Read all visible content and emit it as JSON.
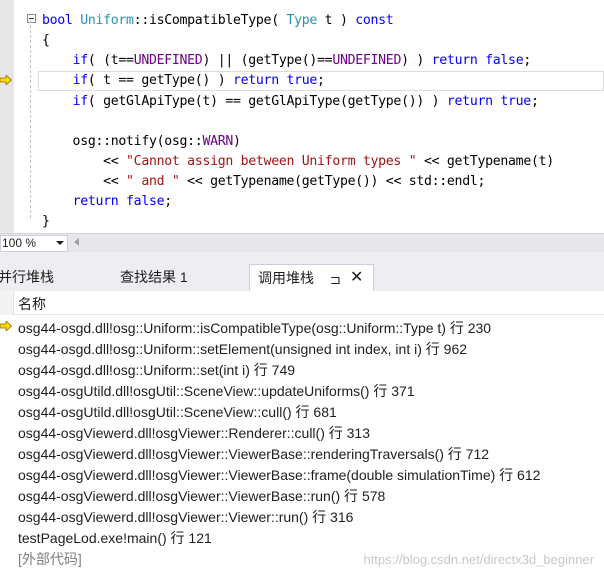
{
  "editor": {
    "lines": [
      [
        {
          "t": "bool",
          "c": "kw"
        },
        {
          "t": " "
        },
        {
          "t": "Uniform",
          "c": "ty"
        },
        {
          "t": "::isCompatibleType( "
        },
        {
          "t": "Type",
          "c": "ty"
        },
        {
          "t": " t ) "
        },
        {
          "t": "const",
          "c": "kw"
        }
      ],
      [
        {
          "t": "{"
        }
      ],
      [
        {
          "t": "    "
        },
        {
          "t": "if",
          "c": "kw"
        },
        {
          "t": "( (t=="
        },
        {
          "t": "UNDEFINED",
          "c": "mac"
        },
        {
          "t": ") || (getType()=="
        },
        {
          "t": "UNDEFINED",
          "c": "mac"
        },
        {
          "t": ") ) "
        },
        {
          "t": "return",
          "c": "kw"
        },
        {
          "t": " "
        },
        {
          "t": "false",
          "c": "kw"
        },
        {
          "t": ";"
        }
      ],
      [
        {
          "t": "    "
        },
        {
          "t": "if",
          "c": "kw"
        },
        {
          "t": "( t == getType() ) "
        },
        {
          "t": "return",
          "c": "kw"
        },
        {
          "t": " "
        },
        {
          "t": "true",
          "c": "kw"
        },
        {
          "t": ";"
        }
      ],
      [
        {
          "t": "    "
        },
        {
          "t": "if",
          "c": "kw"
        },
        {
          "t": "( getGlApiType(t) == getGlApiType(getType()) ) "
        },
        {
          "t": "return",
          "c": "kw"
        },
        {
          "t": " "
        },
        {
          "t": "true",
          "c": "kw"
        },
        {
          "t": ";"
        }
      ],
      [
        {
          "t": ""
        }
      ],
      [
        {
          "t": "    osg::notify(osg::"
        },
        {
          "t": "WARN",
          "c": "mac"
        },
        {
          "t": ")"
        }
      ],
      [
        {
          "t": "        << "
        },
        {
          "t": "\"Cannot assign between Uniform types \"",
          "c": "str"
        },
        {
          "t": " << getTypename(t)"
        }
      ],
      [
        {
          "t": "        << "
        },
        {
          "t": "\" and \"",
          "c": "str"
        },
        {
          "t": " << getTypename(getType()) << std::endl;"
        }
      ],
      [
        {
          "t": "    "
        },
        {
          "t": "return",
          "c": "kw"
        },
        {
          "t": " "
        },
        {
          "t": "false",
          "c": "kw"
        },
        {
          "t": ";"
        }
      ],
      [
        {
          "t": "}"
        }
      ]
    ]
  },
  "zoom": {
    "value": "100 %"
  },
  "tabs": {
    "parallel_stacks": "并行堆栈",
    "find_results": "查找结果 1",
    "call_stack": "调用堆栈",
    "pin_glyph": "⊐",
    "close_glyph": "✕"
  },
  "callstack": {
    "column_name": "名称",
    "frames": [
      "osg44-osgd.dll!osg::Uniform::isCompatibleType(osg::Uniform::Type t) 行 230",
      "osg44-osgd.dll!osg::Uniform::setElement(unsigned int index, int i) 行 962",
      "osg44-osgd.dll!osg::Uniform::set(int i) 行 749",
      "osg44-osgUtild.dll!osgUtil::SceneView::updateUniforms() 行 371",
      "osg44-osgUtild.dll!osgUtil::SceneView::cull() 行 681",
      "osg44-osgViewerd.dll!osgViewer::Renderer::cull() 行 313",
      "osg44-osgViewerd.dll!osgViewer::ViewerBase::renderingTraversals() 行 712",
      "osg44-osgViewerd.dll!osgViewer::ViewerBase::frame(double simulationTime) 行 612",
      "osg44-osgViewerd.dll!osgViewer::ViewerBase::run() 行 578",
      "osg44-osgViewerd.dll!osgViewer::Viewer::run() 行 316",
      "testPageLod.exe!main() 行 121",
      "[外部代码]"
    ],
    "watermark": "https://blog.csdn.net/directx3d_beginner"
  },
  "colors": {
    "arrow_fill": "#ffd800",
    "arrow_stroke": "#8a6d00",
    "keyword": "#0000ff",
    "type": "#2b91af",
    "string": "#a31515",
    "macro": "#6f008a"
  }
}
